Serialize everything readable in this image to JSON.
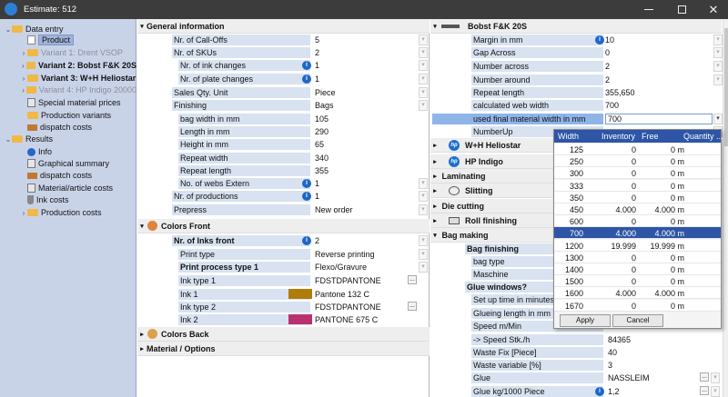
{
  "window": {
    "title": "Estimate: 512",
    "accent": "#2e55a6"
  },
  "tree": [
    {
      "label": "Data entry",
      "icon": "folder-icon",
      "toggle": "⌄",
      "indent": 0,
      "style": ""
    },
    {
      "label": "Product",
      "icon": "page-icon",
      "toggle": "",
      "indent": 1,
      "style": "selected"
    },
    {
      "label": "Variant 1: Drent VSOP",
      "icon": "folder-icon",
      "toggle": "›",
      "indent": 1,
      "style": "grey"
    },
    {
      "label": "Variant 2: Bobst F&K 20S",
      "icon": "folder-icon",
      "toggle": "›",
      "indent": 1,
      "style": "bold"
    },
    {
      "label": "Variant 3: W+H Heliostar",
      "icon": "folder-icon",
      "toggle": "›",
      "indent": 1,
      "style": "bold"
    },
    {
      "label": "Variant 4: HP Indigo 20000",
      "icon": "folder-icon",
      "toggle": "›",
      "indent": 1,
      "style": "grey"
    },
    {
      "label": "Special material prices",
      "icon": "sheet-icon",
      "toggle": "",
      "indent": 1,
      "style": ""
    },
    {
      "label": "Production variants",
      "icon": "folder-icon",
      "toggle": "",
      "indent": 1,
      "style": ""
    },
    {
      "label": "dispatch costs",
      "icon": "truck-icon",
      "toggle": "",
      "indent": 1,
      "style": ""
    },
    {
      "label": "Results",
      "icon": "folder-icon",
      "toggle": "⌄",
      "indent": 0,
      "style": ""
    },
    {
      "label": "Info",
      "icon": "info-icon",
      "toggle": "",
      "indent": 1,
      "style": ""
    },
    {
      "label": "Graphical summary",
      "icon": "sheet-icon",
      "toggle": "",
      "indent": 1,
      "style": ""
    },
    {
      "label": "dispatch costs",
      "icon": "truck-icon",
      "toggle": "",
      "indent": 1,
      "style": ""
    },
    {
      "label": "Material/article costs",
      "icon": "sheet-icon",
      "toggle": "",
      "indent": 1,
      "style": ""
    },
    {
      "label": "Ink costs",
      "icon": "flask-icon",
      "toggle": "",
      "indent": 1,
      "style": ""
    },
    {
      "label": "Production costs",
      "icon": "folder-icon",
      "toggle": "›",
      "indent": 1,
      "style": ""
    }
  ],
  "general": {
    "title": "General information",
    "rows": [
      {
        "label": "Nr. of Call-Offs",
        "value": "5",
        "info": false,
        "dd": true,
        "sub": false,
        "bold": false
      },
      {
        "label": "Nr. of SKUs",
        "value": "2",
        "info": false,
        "dd": true,
        "sub": false,
        "bold": false
      },
      {
        "label": "Nr. of ink changes",
        "value": "1",
        "info": true,
        "dd": true,
        "sub": true,
        "bold": false
      },
      {
        "label": "Nr. of plate changes",
        "value": "1",
        "info": true,
        "dd": true,
        "sub": true,
        "bold": false
      },
      {
        "label": "Sales Qty. Unit",
        "value": "Piece",
        "info": false,
        "dd": true,
        "sub": false,
        "bold": false
      },
      {
        "label": "Finishing",
        "value": "Bags",
        "info": false,
        "dd": true,
        "sub": false,
        "bold": false
      },
      {
        "label": "bag width in mm",
        "value": "105",
        "info": false,
        "dd": false,
        "sub": true,
        "bold": false
      },
      {
        "label": "Length in  mm",
        "value": "290",
        "info": false,
        "dd": false,
        "sub": true,
        "bold": false
      },
      {
        "label": "Height in mm",
        "value": "65",
        "info": false,
        "dd": false,
        "sub": true,
        "bold": false
      },
      {
        "label": "Repeat width",
        "value": "340",
        "info": false,
        "dd": false,
        "sub": true,
        "bold": false
      },
      {
        "label": "Repeat length",
        "value": "355",
        "info": false,
        "dd": false,
        "sub": true,
        "bold": false
      },
      {
        "label": "No. of webs Extern",
        "value": "1",
        "info": true,
        "dd": true,
        "sub": true,
        "bold": false
      },
      {
        "label": "Nr. of productions",
        "value": "1",
        "info": true,
        "dd": true,
        "sub": false,
        "bold": false
      },
      {
        "label": "Prepress",
        "value": "New order",
        "info": false,
        "dd": true,
        "sub": false,
        "bold": false
      }
    ]
  },
  "colors_front": {
    "title": "Colors Front",
    "rows": [
      {
        "label": "Nr. of Inks front",
        "value": "2",
        "info": true,
        "dd": true,
        "ell": false,
        "swatch": "",
        "sub": false,
        "bold": true
      },
      {
        "label": "Print type",
        "value": "Reverse printing",
        "info": false,
        "dd": true,
        "ell": false,
        "swatch": "",
        "sub": true,
        "bold": false
      },
      {
        "label": "Print process type 1",
        "value": "Flexo/Gravure",
        "info": false,
        "dd": true,
        "ell": false,
        "swatch": "",
        "sub": true,
        "bold": true
      },
      {
        "label": "Ink type 1",
        "value": "FDSTDPANTONE",
        "info": false,
        "dd": false,
        "ell": true,
        "swatch": "",
        "sub": true,
        "bold": false
      },
      {
        "label": "Ink 1",
        "value": "Pantone 132 C",
        "info": false,
        "dd": false,
        "ell": false,
        "swatch": "#b07c0a",
        "sub": true,
        "bold": false
      },
      {
        "label": "Ink type 2",
        "value": "FDSTDPANTONE",
        "info": false,
        "dd": false,
        "ell": true,
        "swatch": "",
        "sub": true,
        "bold": false
      },
      {
        "label": "Ink 2",
        "value": "PANTONE 675 C",
        "info": false,
        "dd": false,
        "ell": false,
        "swatch": "#b9326f",
        "sub": true,
        "bold": false
      }
    ]
  },
  "colors_back": {
    "title": "Colors Back"
  },
  "material": {
    "title": "Material / Options"
  },
  "right": {
    "bobst_title": "Bobst F&K 20S",
    "bobst_rows": [
      {
        "label": "Margin in mm",
        "value": "10",
        "info": true
      },
      {
        "label": "Gap Across",
        "value": "0",
        "info": false
      },
      {
        "label": "Number across",
        "value": "2",
        "info": false
      },
      {
        "label": "Number around",
        "value": "2",
        "info": false
      },
      {
        "label": "Repeat length",
        "value": "355,650",
        "info": false
      },
      {
        "label": "calculated web width",
        "value": "700",
        "info": false
      },
      {
        "label": "used final material width in mm",
        "value": "700",
        "info": false
      },
      {
        "label": "NumberUp",
        "value": "",
        "info": false
      }
    ],
    "sections": [
      {
        "label": "W+H Heliostar",
        "icon": "hp-logo-icon"
      },
      {
        "label": "HP Indigo",
        "icon": "hp-logo-icon"
      },
      {
        "label": "Laminating",
        "icon": ""
      },
      {
        "label": "Slitting",
        "icon": "slitting-icon"
      },
      {
        "label": "Die cutting",
        "icon": ""
      },
      {
        "label": "Roll finishing",
        "icon": "roll-icon"
      },
      {
        "label": "Bag making",
        "icon": ""
      }
    ],
    "bag_rows": [
      {
        "label": "Bag finishing",
        "value": "",
        "bold": true,
        "info": false,
        "ell": false
      },
      {
        "label": "bag type",
        "value": "",
        "bold": false,
        "info": false,
        "ell": false
      },
      {
        "label": "Maschine",
        "value": "",
        "bold": false,
        "info": false,
        "ell": false
      },
      {
        "label": "Glue windows?",
        "value": "",
        "bold": true,
        "info": false,
        "ell": false
      },
      {
        "label": "Set up time in minutes",
        "value": "",
        "bold": false,
        "info": false,
        "ell": false
      },
      {
        "label": "Glueing length in mm",
        "value": "",
        "bold": false,
        "info": false,
        "ell": false
      },
      {
        "label": "Speed m/Min",
        "value": "",
        "bold": false,
        "info": false,
        "ell": false
      },
      {
        "label": "-> Speed Stk./h",
        "value": "84365",
        "bold": false,
        "info": false,
        "ell": false
      },
      {
        "label": "Waste Fix [Piece]",
        "value": "40",
        "bold": false,
        "info": false,
        "ell": false
      },
      {
        "label": "Waste variable [%]",
        "value": "3",
        "bold": false,
        "info": false,
        "ell": false
      },
      {
        "label": "Glue",
        "value": "NASSLEIM",
        "bold": false,
        "info": false,
        "ell": true
      },
      {
        "label": "Glue kg/1000 Piece",
        "value": "1,2",
        "bold": false,
        "info": true,
        "ell": true
      }
    ]
  },
  "popup": {
    "headers": [
      "Width",
      "Inventory",
      "Free",
      "Quantity ..."
    ],
    "rows": [
      [
        "125",
        "0",
        "0 m",
        ""
      ],
      [
        "250",
        "0",
        "0 m",
        ""
      ],
      [
        "300",
        "0",
        "0 m",
        ""
      ],
      [
        "333",
        "0",
        "0 m",
        ""
      ],
      [
        "350",
        "0",
        "0 m",
        ""
      ],
      [
        "450",
        "4.000",
        "4.000 m",
        ""
      ],
      [
        "600",
        "0",
        "0 m",
        ""
      ],
      [
        "700",
        "4.000",
        "4.000 m",
        ""
      ],
      [
        "1200",
        "19.999",
        "19.999 m",
        ""
      ],
      [
        "1300",
        "0",
        "0 m",
        ""
      ],
      [
        "1400",
        "0",
        "0 m",
        ""
      ],
      [
        "1500",
        "0",
        "0 m",
        ""
      ],
      [
        "1600",
        "4.000",
        "4.000 m",
        ""
      ],
      [
        "1670",
        "0",
        "0 m",
        ""
      ]
    ],
    "selected_width": "700",
    "apply_label": "Apply",
    "cancel_label": "Cancel"
  }
}
